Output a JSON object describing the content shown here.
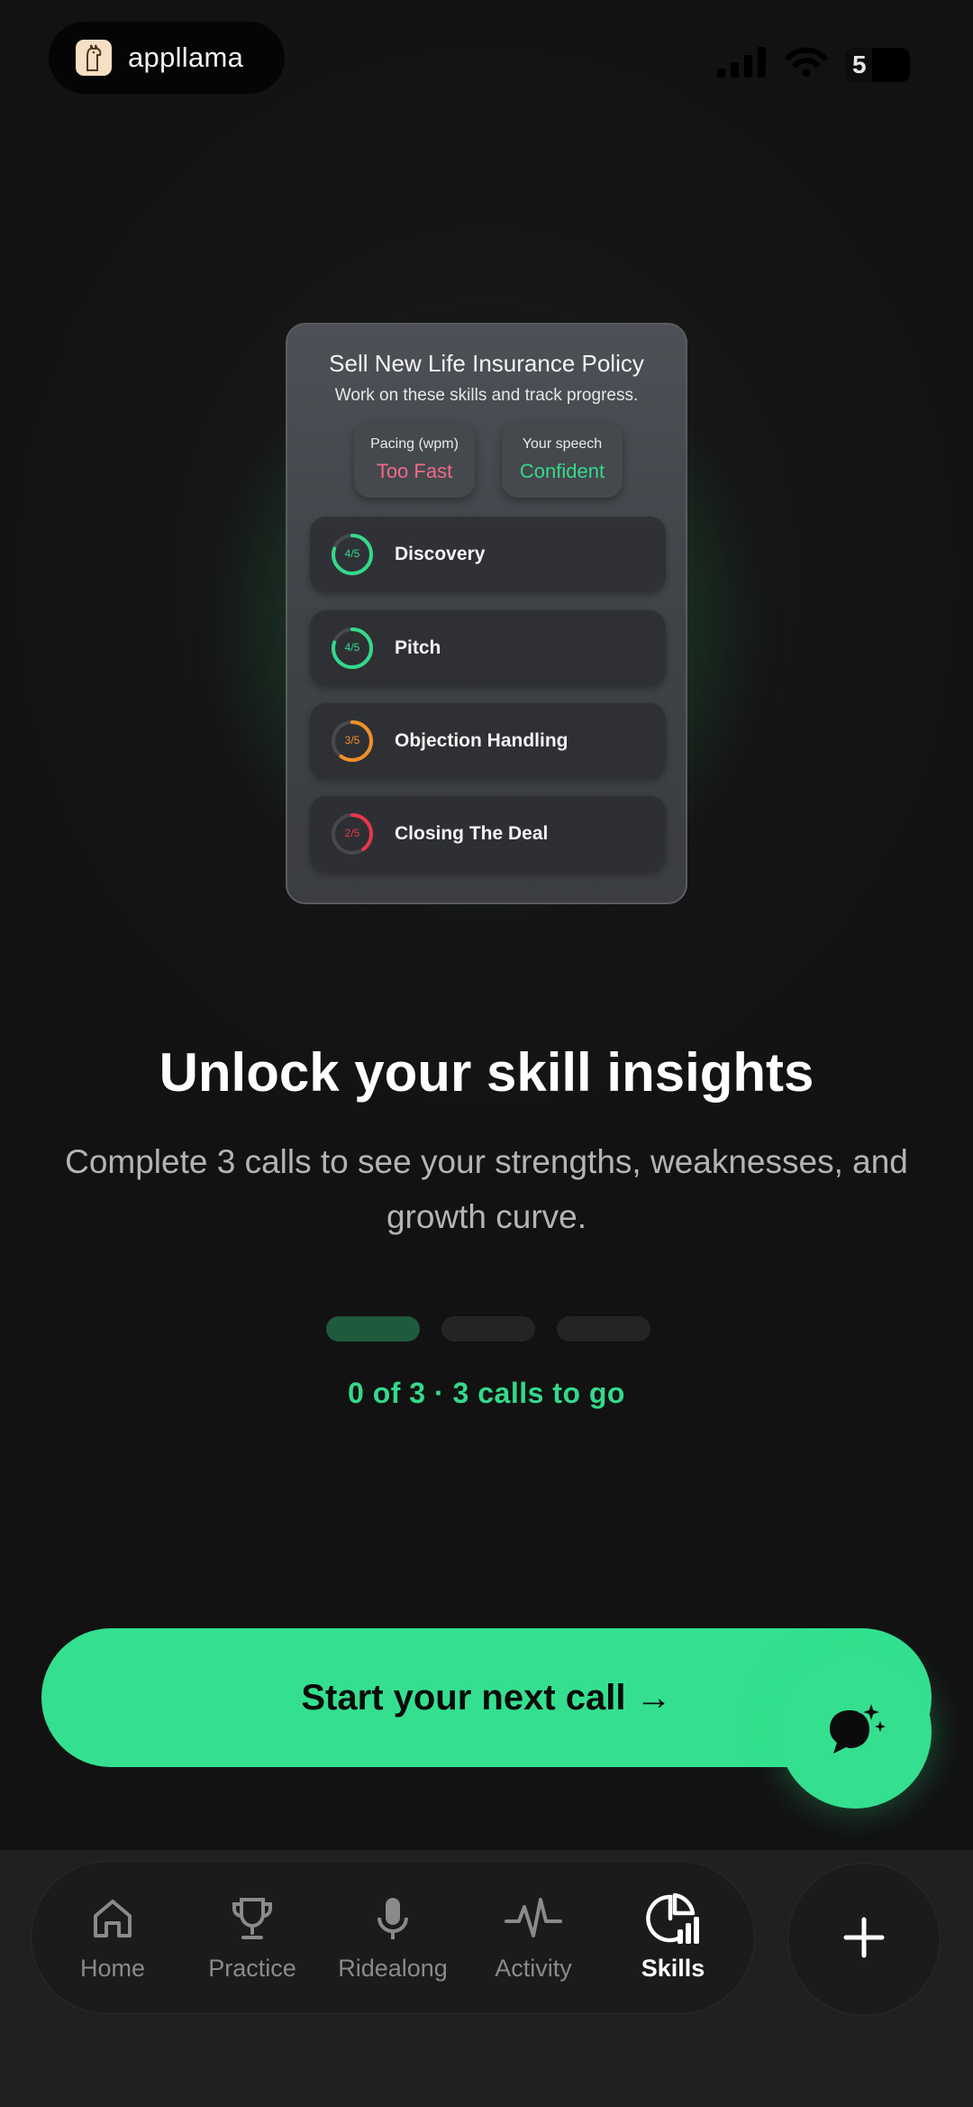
{
  "status_bar": {
    "brand_name": "appllama",
    "battery_level": "5"
  },
  "preview_card": {
    "title": "Sell New Life Insurance Policy",
    "subtitle": "Work on these skills and track progress.",
    "metrics": [
      {
        "label": "Pacing (wpm)",
        "value": "Too Fast",
        "color": "#f06a87"
      },
      {
        "label": "Your speech",
        "value": "Confident",
        "color": "#34d98b"
      }
    ],
    "skills": [
      {
        "name": "Discovery",
        "score": "4/5",
        "progress": 0.8,
        "color": "#34d98b"
      },
      {
        "name": "Pitch",
        "score": "4/5",
        "progress": 0.8,
        "color": "#34d98b"
      },
      {
        "name": "Objection Handling",
        "score": "3/5",
        "progress": 0.6,
        "color": "#f0902a"
      },
      {
        "name": "Closing The Deal",
        "score": "2/5",
        "progress": 0.4,
        "color": "#e8364a"
      }
    ]
  },
  "main": {
    "headline": "Unlock your skill insights",
    "subtext": "Complete 3 calls to see your strengths, weaknesses, and growth curve.",
    "progress": {
      "completed": 0,
      "total": 3,
      "label": "0 of 3 · 3 calls to go"
    },
    "cta_label": "Start your next call →"
  },
  "nav": {
    "items": [
      {
        "label": "Home",
        "icon": "home-icon",
        "active": false
      },
      {
        "label": "Practice",
        "icon": "trophy-icon",
        "active": false
      },
      {
        "label": "Ridealong",
        "icon": "microphone-icon",
        "active": false
      },
      {
        "label": "Activity",
        "icon": "activity-icon",
        "active": false
      },
      {
        "label": "Skills",
        "icon": "skills-chart-icon",
        "active": true
      }
    ]
  },
  "colors": {
    "accent": "#34e08f",
    "background": "#121212"
  }
}
